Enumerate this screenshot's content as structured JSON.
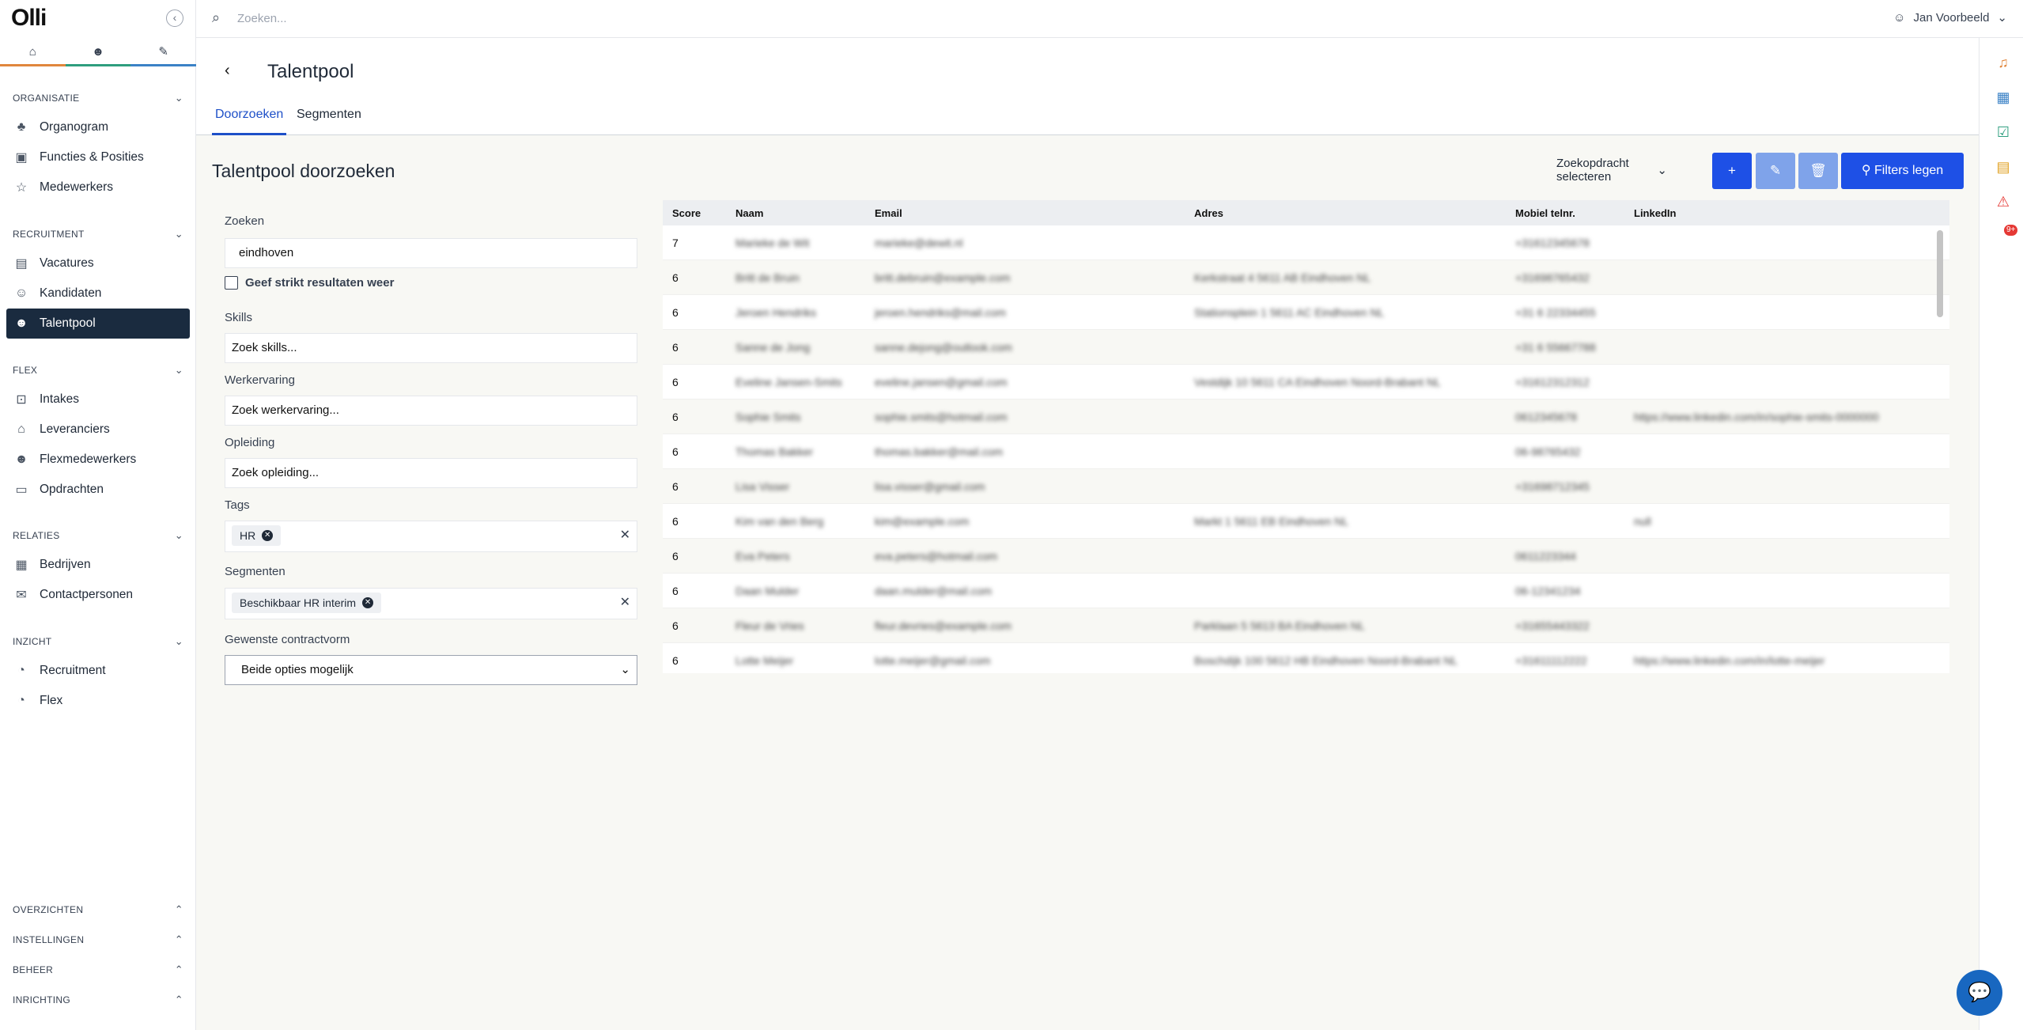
{
  "app": {
    "logo": "Olli"
  },
  "topnav": [
    {
      "icon": "home-icon",
      "color": "#e0863c"
    },
    {
      "icon": "users-icon",
      "color": "#2e9e7e"
    },
    {
      "icon": "tasks-icon",
      "color": "#3b82c6"
    }
  ],
  "sidebar": {
    "organisatie": {
      "title": "ORGANISATIE",
      "items": [
        "Organogram",
        "Functies & Posities",
        "Medewerkers"
      ]
    },
    "recruitment": {
      "title": "RECRUITMENT",
      "items": [
        "Vacatures",
        "Kandidaten",
        "Talentpool"
      ]
    },
    "flex": {
      "title": "FLEX",
      "items": [
        "Intakes",
        "Leveranciers",
        "Flexmedewerkers",
        "Opdrachten"
      ]
    },
    "relaties": {
      "title": "RELATIES",
      "items": [
        "Bedrijven",
        "Contactpersonen"
      ]
    },
    "inzicht": {
      "title": "INZICHT",
      "items": [
        "Recruitment",
        "Flex"
      ]
    },
    "bottom": [
      "OVERZICHTEN",
      "INSTELLINGEN",
      "BEHEER",
      "INRICHTING"
    ]
  },
  "topbar": {
    "search_placeholder": "Zoeken...",
    "user": "Jan Voorbeeld"
  },
  "rail": {
    "badge": "9+"
  },
  "header": {
    "title": "Talentpool",
    "tabs": [
      "Doorzoeken",
      "Segmenten"
    ]
  },
  "main": {
    "title": "Talentpool doorzoeken",
    "zoekopdracht": "Zoekopdracht selecteren",
    "filters_btn": "Filters legen",
    "filters": {
      "zoeken_label": "Zoeken",
      "zoeken_value": "eindhoven",
      "strict_label": "Geef strikt resultaten weer",
      "skills_label": "Skills",
      "skills_value": "Zoek skills...",
      "werk_label": "Werkervaring",
      "werk_value": "Zoek werkervaring...",
      "opl_label": "Opleiding",
      "opl_value": "Zoek opleiding...",
      "tags_label": "Tags",
      "tags": [
        "HR"
      ],
      "seg_label": "Segmenten",
      "segmenten": [
        "Beschikbaar HR interim"
      ],
      "contract_label": "Gewenste contractvorm",
      "contract_value": "Beide opties mogelijk"
    },
    "table": {
      "headers": [
        "Score",
        "Naam",
        "Email",
        "Adres",
        "Mobiel telnr.",
        "LinkedIn"
      ],
      "rows": [
        [
          "7",
          "Marieke de Wit",
          "marieke@dewit.nl",
          "",
          "+31612345678",
          ""
        ],
        [
          "6",
          "Britt de Bruin",
          "britt.debruin@example.com",
          "Kerkstraat 4 5611 AB Eindhoven NL",
          "+31698765432",
          ""
        ],
        [
          "6",
          "Jeroen Hendriks",
          "jeroen.hendriks@mail.com",
          "Stationsplein 1 5611 AC Eindhoven NL",
          "+31 6 22334455",
          ""
        ],
        [
          "6",
          "Sanne de Jong",
          "sanne.dejong@outlook.com",
          "",
          "+31 6 55667788",
          ""
        ],
        [
          "6",
          "Eveline Jansen-Smits",
          "eveline.jansen@gmail.com",
          "Vestdijk 10 5611 CA Eindhoven Noord-Brabant NL",
          "+31612312312",
          ""
        ],
        [
          "6",
          "Sophie Smits",
          "sophie.smits@hotmail.com",
          "",
          "0612345678",
          "https://www.linkedin.com/in/sophie-smits-0000000"
        ],
        [
          "6",
          "Thomas Bakker",
          "thomas.bakker@mail.com",
          "",
          "06-98765432",
          ""
        ],
        [
          "6",
          "Lisa Visser",
          "lisa.visser@gmail.com",
          "",
          "+31698712345",
          ""
        ],
        [
          "6",
          "Kim van den Berg",
          "kim@example.com",
          "Markt 1 5611 EB Eindhoven NL",
          "",
          "null"
        ],
        [
          "6",
          "Eva Peters",
          "eva.peters@hotmail.com",
          "",
          "0611223344",
          ""
        ],
        [
          "6",
          "Daan Mulder",
          "daan.mulder@mail.com",
          "",
          "06-12341234",
          ""
        ],
        [
          "6",
          "Fleur de Vries",
          "fleur.devries@example.com",
          "Parklaan 5 5613 BA Eindhoven NL",
          "+31655443322",
          ""
        ],
        [
          "6",
          "Lotte Meijer",
          "lotte.meijer@gmail.com",
          "Boschdijk 100 5612 HB Eindhoven Noord-Brabant NL",
          "+31611112222",
          "https://www.linkedin.com/in/lotte-meijer"
        ]
      ]
    }
  }
}
